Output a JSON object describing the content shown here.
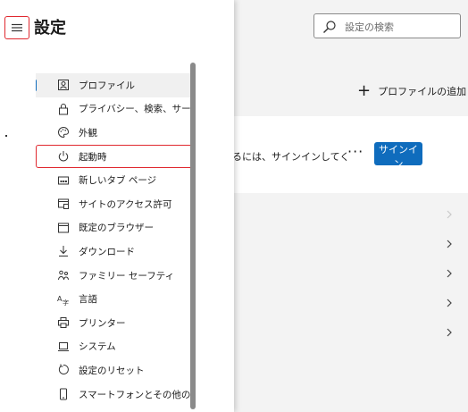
{
  "header": {
    "title": "設定",
    "search_placeholder": "設定の検索"
  },
  "main": {
    "add_profile_label": "プロファイルの追加",
    "signin_prompt": "るには、サインインしてく",
    "more_label": "···",
    "signin_button": "サインイン"
  },
  "sidebar": {
    "items": [
      {
        "label": "プロファイル",
        "icon": "profile-icon"
      },
      {
        "label": "プライバシー、検索、サービス",
        "icon": "lock-icon"
      },
      {
        "label": "外観",
        "icon": "palette-icon"
      },
      {
        "label": "起動時",
        "icon": "power-icon"
      },
      {
        "label": "新しいタブ ページ",
        "icon": "new-tab-icon"
      },
      {
        "label": "サイトのアクセス許可",
        "icon": "site-permissions-icon"
      },
      {
        "label": "既定のブラウザー",
        "icon": "default-browser-icon"
      },
      {
        "label": "ダウンロード",
        "icon": "download-icon"
      },
      {
        "label": "ファミリー セーフティ",
        "icon": "family-icon"
      },
      {
        "label": "言語",
        "icon": "language-icon"
      },
      {
        "label": "プリンター",
        "icon": "printer-icon"
      },
      {
        "label": "システム",
        "icon": "system-icon"
      },
      {
        "label": "設定のリセット",
        "icon": "reset-icon"
      },
      {
        "label": "スマートフォンとその他のデバイス",
        "icon": "phone-icon"
      }
    ],
    "active_index": 0,
    "highlighted_index": 3
  },
  "colors": {
    "accent": "#0f6cbd",
    "highlight_border": "#e0282f",
    "background": "#f3f3f3"
  }
}
